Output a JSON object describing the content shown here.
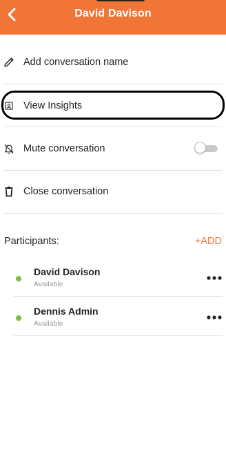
{
  "header": {
    "title": "David Davison",
    "back_icon": "chevron-left-icon",
    "background_color": "#f07536"
  },
  "menu": {
    "items": [
      {
        "label": "Add conversation name",
        "icon": "pencil-icon"
      },
      {
        "label": "View Insights",
        "icon": "insights-icon"
      },
      {
        "label": "Mute conversation",
        "icon": "bell-off-icon",
        "toggle_on": false
      },
      {
        "label": "Close conversation",
        "icon": "trash-icon"
      }
    ]
  },
  "participants": {
    "heading": "Participants:",
    "add_label": "+ADD",
    "accent_color": "#f07536",
    "list": [
      {
        "name": "David Davison",
        "status": "Available",
        "status_color": "#7fbf3e"
      },
      {
        "name": "Dennis Admin",
        "status": "Available",
        "status_color": "#7fbf3e"
      }
    ]
  }
}
